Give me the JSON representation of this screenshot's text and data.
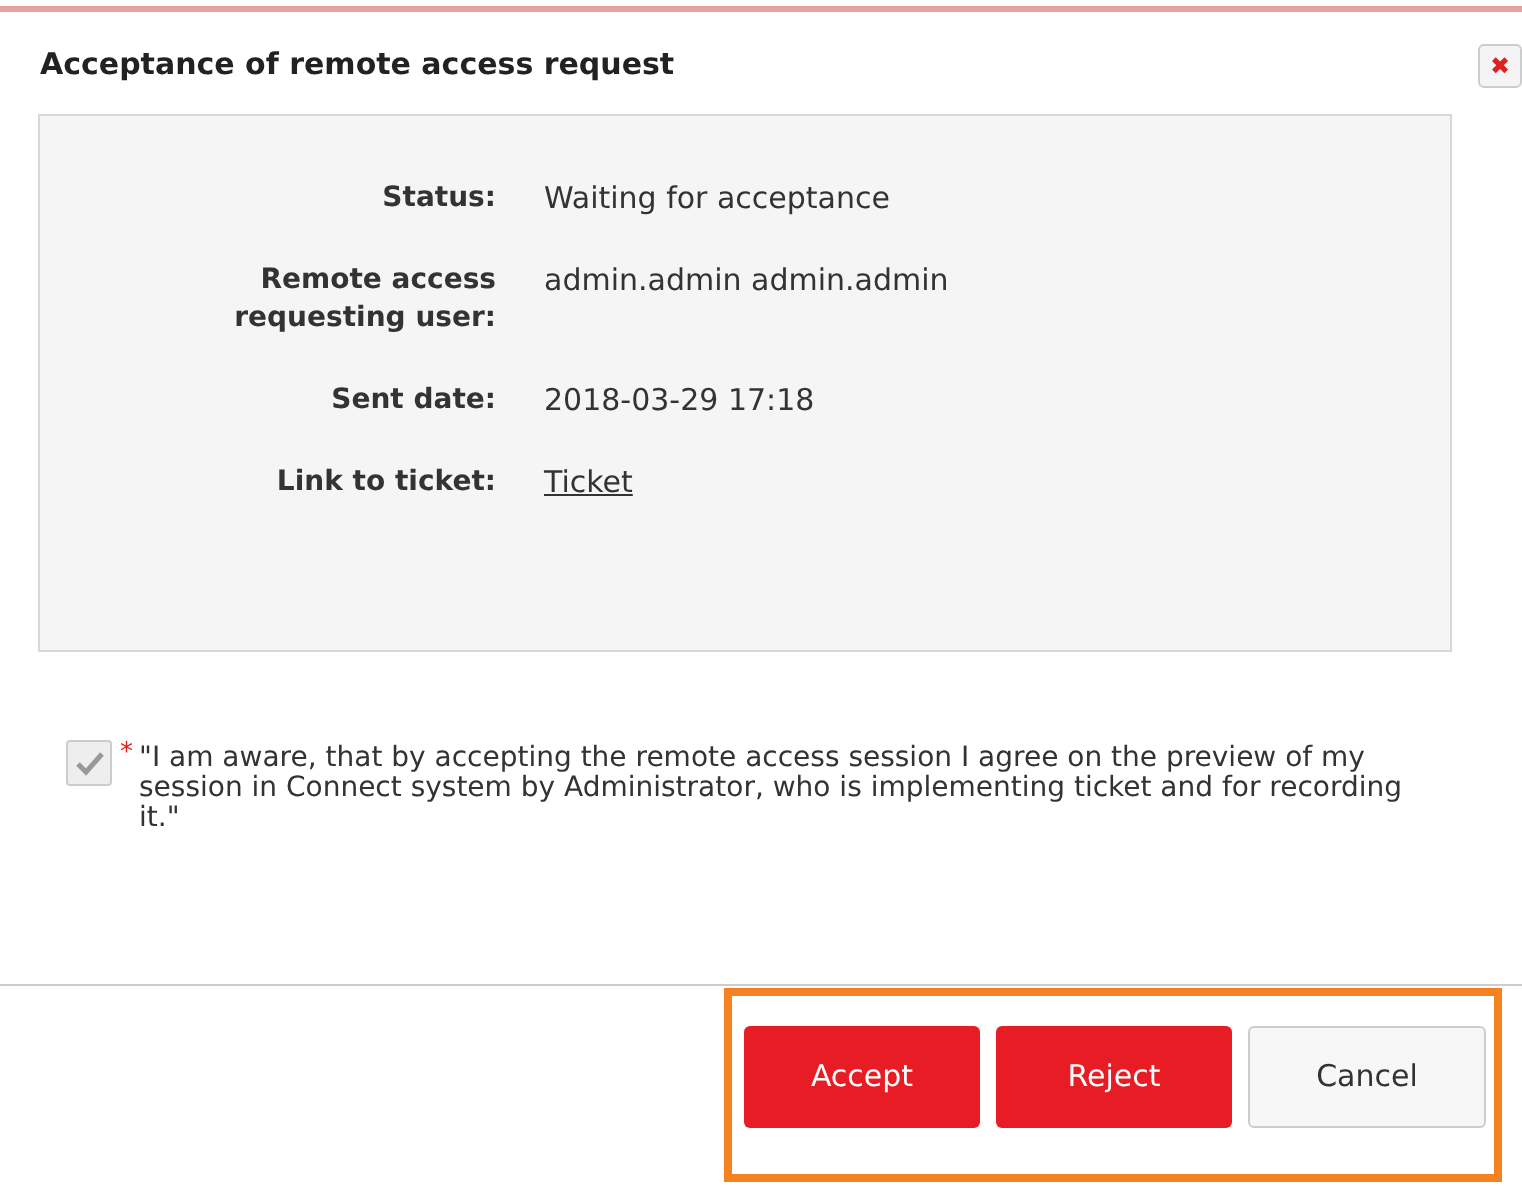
{
  "dialog": {
    "title": "Acceptance of remote access request",
    "close_icon": "✖"
  },
  "details": [
    {
      "label": "Status:",
      "value": "Waiting for acceptance",
      "kind": "text"
    },
    {
      "label": "Remote access requesting user:",
      "value": "admin.admin admin.admin",
      "kind": "text"
    },
    {
      "label": "Sent date:",
      "value": "2018-03-29 17:18",
      "kind": "text"
    },
    {
      "label": "Link to ticket:",
      "value": "Ticket",
      "kind": "link"
    }
  ],
  "consent": {
    "checked": true,
    "required_mark": "*",
    "text": "\"I am aware, that by accepting the remote access session I agree on the preview of my session in Connect system by Administrator, who is implementing ticket and for recording it.\""
  },
  "buttons": [
    {
      "label": "Accept",
      "kind": "primary"
    },
    {
      "label": "Reject",
      "kind": "primary"
    },
    {
      "label": "Cancel",
      "kind": "default"
    }
  ],
  "highlight": {
    "on": true
  }
}
